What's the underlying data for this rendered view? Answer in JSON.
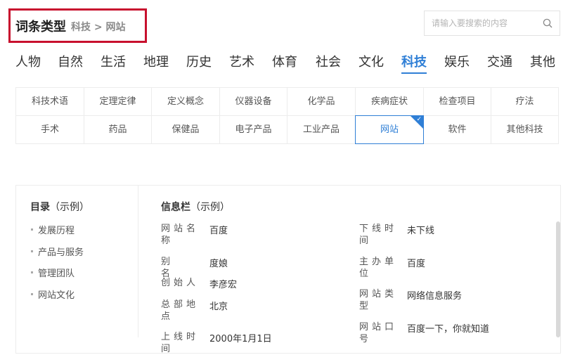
{
  "header": {
    "title": "词条类型",
    "breadcrumb": "科技 > 网站"
  },
  "search": {
    "placeholder": "请输入要搜索的内容",
    "icon": "search-icon"
  },
  "categories": [
    "人物",
    "自然",
    "生活",
    "地理",
    "历史",
    "艺术",
    "体育",
    "社会",
    "文化",
    "科技",
    "娱乐",
    "交通",
    "其他"
  ],
  "active_category": "科技",
  "subcategories": [
    [
      "科技术语",
      "定理定律",
      "定义概念",
      "仪器设备",
      "化学品",
      "疾病症状",
      "检查项目",
      "疗法"
    ],
    [
      "手术",
      "药品",
      "保健品",
      "电子产品",
      "工业产品",
      "网站",
      "软件",
      "其他科技"
    ]
  ],
  "active_subcategory": "网站",
  "colors": {
    "accent": "#2f7fd6",
    "highlight_border": "#c8102e"
  },
  "toc": {
    "title": "目录",
    "suffix": "（示例）",
    "items": [
      "发展历程",
      "产品与服务",
      "管理团队",
      "网站文化"
    ]
  },
  "infobox": {
    "title": "信息栏",
    "suffix": "（示例）",
    "left": [
      {
        "label": "网站名称",
        "value": "百度"
      },
      {
        "label": "别名",
        "value": "度娘"
      },
      {
        "label": "创始人",
        "value": "李彦宏"
      },
      {
        "label": "总部地点",
        "value": "北京"
      },
      {
        "label": "上线时间",
        "value": "2000年1月1日"
      }
    ],
    "right": [
      {
        "label": "下线时间",
        "value": "未下线"
      },
      {
        "label": "主办单位",
        "value": "百度"
      },
      {
        "label": "网站类型",
        "value": "网络信息服务"
      },
      {
        "label": "网站口号",
        "value": "百度一下，你就知道"
      }
    ]
  }
}
